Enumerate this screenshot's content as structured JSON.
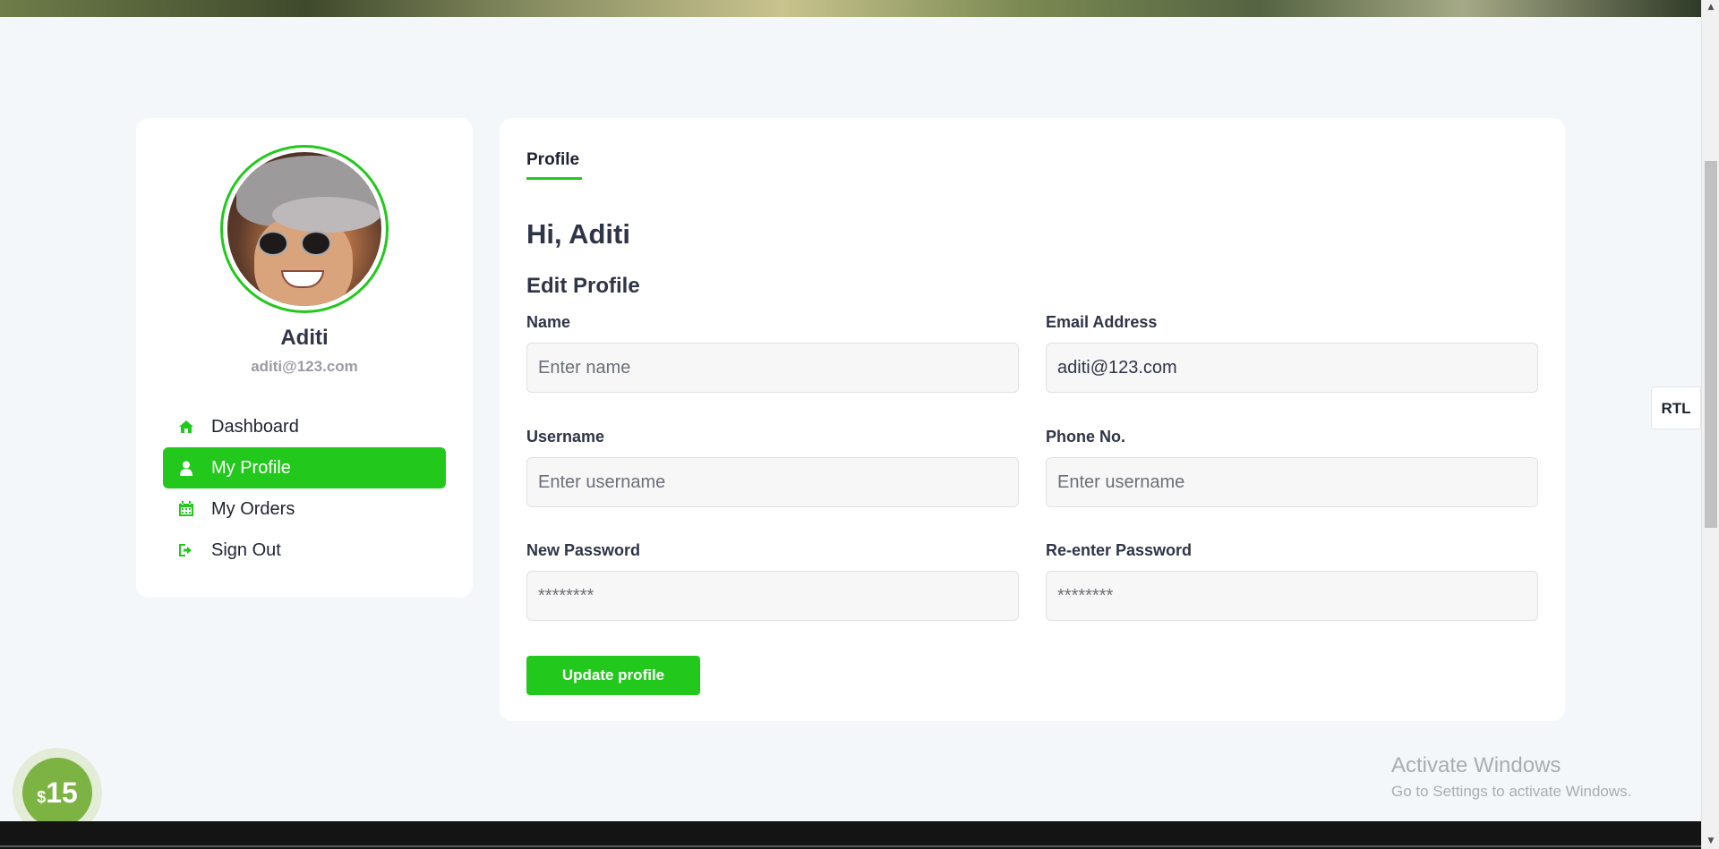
{
  "sidebar": {
    "user_name": "Aditi",
    "user_email": "aditi@123.com",
    "items": [
      {
        "label": "Dashboard",
        "icon": "home-icon",
        "active": false
      },
      {
        "label": "My Profile",
        "icon": "user-icon",
        "active": true
      },
      {
        "label": "My Orders",
        "icon": "calendar-icon",
        "active": false
      },
      {
        "label": "Sign Out",
        "icon": "sign-out-icon",
        "active": false
      }
    ]
  },
  "main": {
    "tab_label": "Profile",
    "greeting": "Hi, Aditi",
    "section_title": "Edit Profile",
    "fields": {
      "name": {
        "label": "Name",
        "value": "",
        "placeholder": "Enter name"
      },
      "email": {
        "label": "Email Address",
        "value": "aditi@123.com",
        "placeholder": ""
      },
      "username": {
        "label": "Username",
        "value": "",
        "placeholder": "Enter username"
      },
      "phone": {
        "label": "Phone No.",
        "value": "",
        "placeholder": "Enter username"
      },
      "new_password": {
        "label": "New Password",
        "value": "",
        "placeholder": "********"
      },
      "reenter_password": {
        "label": "Re-enter Password",
        "value": "",
        "placeholder": "********"
      }
    },
    "update_label": "Update profile"
  },
  "rtl_label": "RTL",
  "price_badge": {
    "currency": "$",
    "value": "15"
  },
  "watermark": {
    "title": "Activate Windows",
    "subtitle": "Go to Settings to activate Windows."
  },
  "colors": {
    "accent": "#22c91c",
    "page_bg": "#f4f7fa",
    "card_bg": "#ffffff",
    "text": "#2f3447"
  }
}
